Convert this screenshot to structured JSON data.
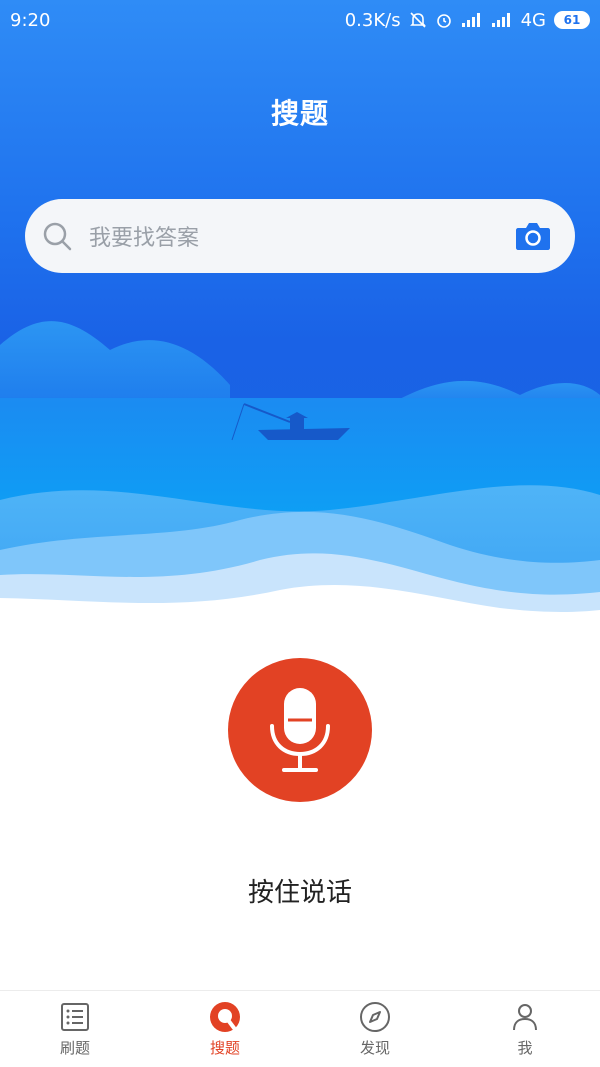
{
  "status_bar": {
    "time": "9:20",
    "network_speed": "0.3K/s",
    "network_type": "4G",
    "battery": "61"
  },
  "header": {
    "title": "搜题"
  },
  "search": {
    "placeholder": "我要找答案"
  },
  "voice": {
    "hold_label": "按住说话"
  },
  "tabs": [
    {
      "label": "刷题",
      "icon": "list-icon"
    },
    {
      "label": "搜题",
      "icon": "search-q-icon",
      "active": true
    },
    {
      "label": "发现",
      "icon": "compass-icon"
    },
    {
      "label": "我",
      "icon": "person-icon"
    }
  ],
  "colors": {
    "primary_blue": "#1f72ee",
    "accent_red": "#e24224"
  }
}
